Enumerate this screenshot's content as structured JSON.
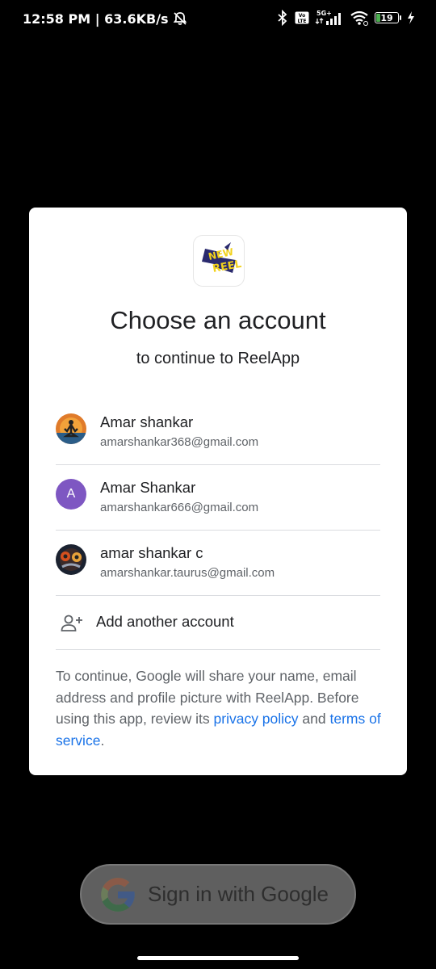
{
  "status_bar": {
    "time_speed": "12:58 PM | 63.6KB/s",
    "battery_level": 19,
    "battery_text": "19",
    "network_label": "5G+",
    "volte_label": "Vo LTE"
  },
  "dialog": {
    "title": "Choose an account",
    "subtitle": "to continue to ReelApp",
    "logo_text": "NEW REEL",
    "accounts": [
      {
        "name": "Amar shankar",
        "email": "amarshankar368@gmail.com",
        "avatar": "photo"
      },
      {
        "name": "Amar Shankar",
        "email": "amarshankar666@gmail.com",
        "avatar": "A"
      },
      {
        "name": "amar shankar c",
        "email": "amarshankar.taurus@gmail.com",
        "avatar": "photo"
      }
    ],
    "add_account_label": "Add another account",
    "disclaimer": {
      "text_before": "To continue, Google will share your name, email address and profile picture with ReelApp. Before using this app, review its ",
      "privacy_link": "privacy policy",
      "text_middle": " and ",
      "terms_link": "terms of service",
      "text_after": "."
    }
  },
  "google_button": {
    "label": "Sign in with Google"
  },
  "colors": {
    "link": "#1a73e8",
    "avatar_letter_bg": "#7e57c2",
    "dialog_bg": "#ffffff",
    "screen_bg": "#000000"
  }
}
